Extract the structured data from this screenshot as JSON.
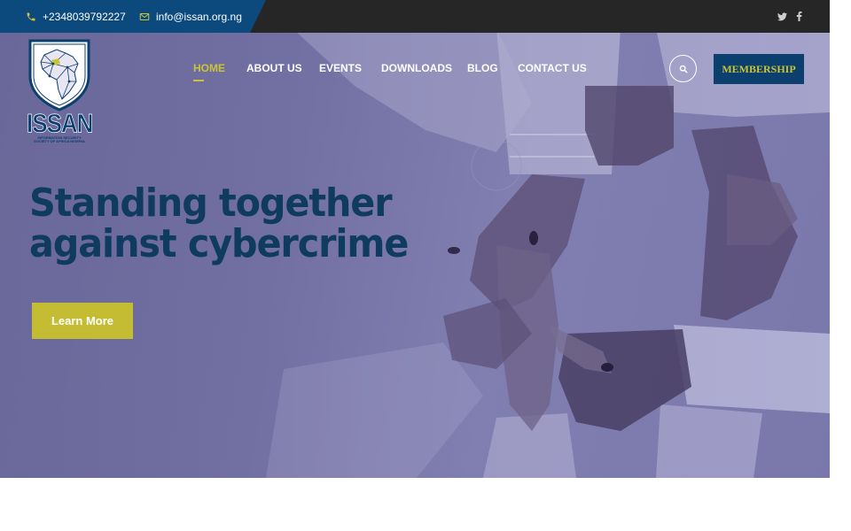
{
  "topbar": {
    "phone": "+2348039792227",
    "email": "info@issan.org.ng",
    "social": [
      {
        "name": "twitter-icon"
      },
      {
        "name": "facebook-icon"
      }
    ]
  },
  "logo": {
    "title": "ISSAN",
    "subtitle": "INFORMATION SECURITY SOCIETY OF AFRICA NIGERIA"
  },
  "nav": {
    "items": [
      {
        "label": "HOME",
        "active": true
      },
      {
        "label": "ABOUT US",
        "active": false
      },
      {
        "label": "EVENTS",
        "active": false
      },
      {
        "label": "DOWNLOADS",
        "active": false
      },
      {
        "label": "BLOG",
        "active": false
      },
      {
        "label": "CONTACT US",
        "active": false
      }
    ],
    "search_icon": "search-icon",
    "membership_label": "MEMBERSHIP"
  },
  "hero": {
    "headline_line1": "Standing together",
    "headline_line2": "against cybercrime",
    "cta_label": "Learn More"
  },
  "colors": {
    "topbar_bg": "#262626",
    "topbar_accent": "#0c4a7e",
    "brand_navy": "#0b3f6e",
    "brand_yellow": "#c9c435",
    "headline": "#0e3b5f"
  }
}
